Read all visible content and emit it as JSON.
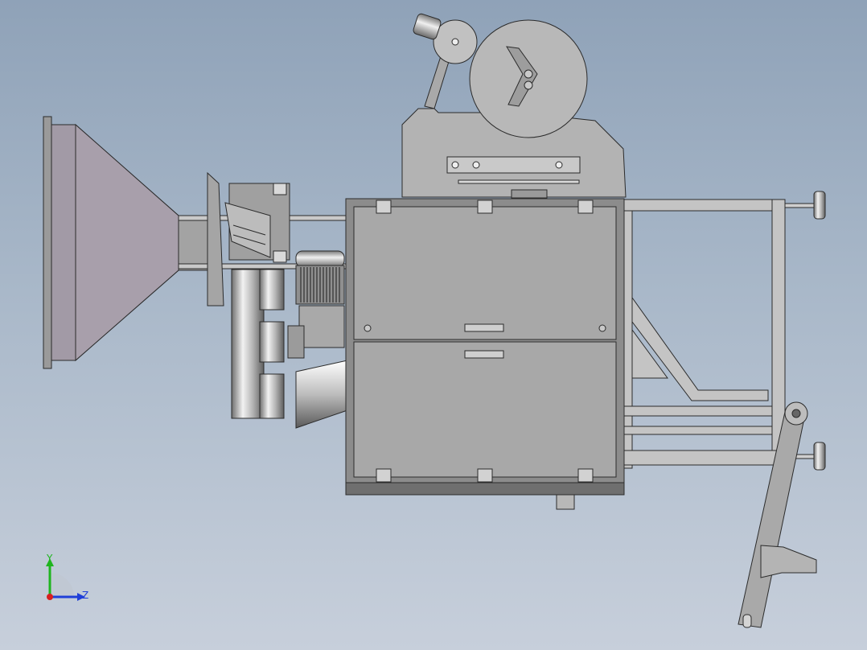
{
  "viewport": {
    "background_top": "#8fa2b8",
    "background_bottom": "#c7cfdb"
  },
  "triad": {
    "y_label": "Y",
    "z_label": "Z",
    "y_color": "#1fb51f",
    "z_color": "#1f3fd8",
    "x_color": "#d81f1f"
  },
  "colors": {
    "body": "#a8a8a8",
    "body_dark": "#8c8c8c",
    "hopper": "#a29aa6",
    "line": "#2b2b2b",
    "frame": "#c4c4c4"
  }
}
